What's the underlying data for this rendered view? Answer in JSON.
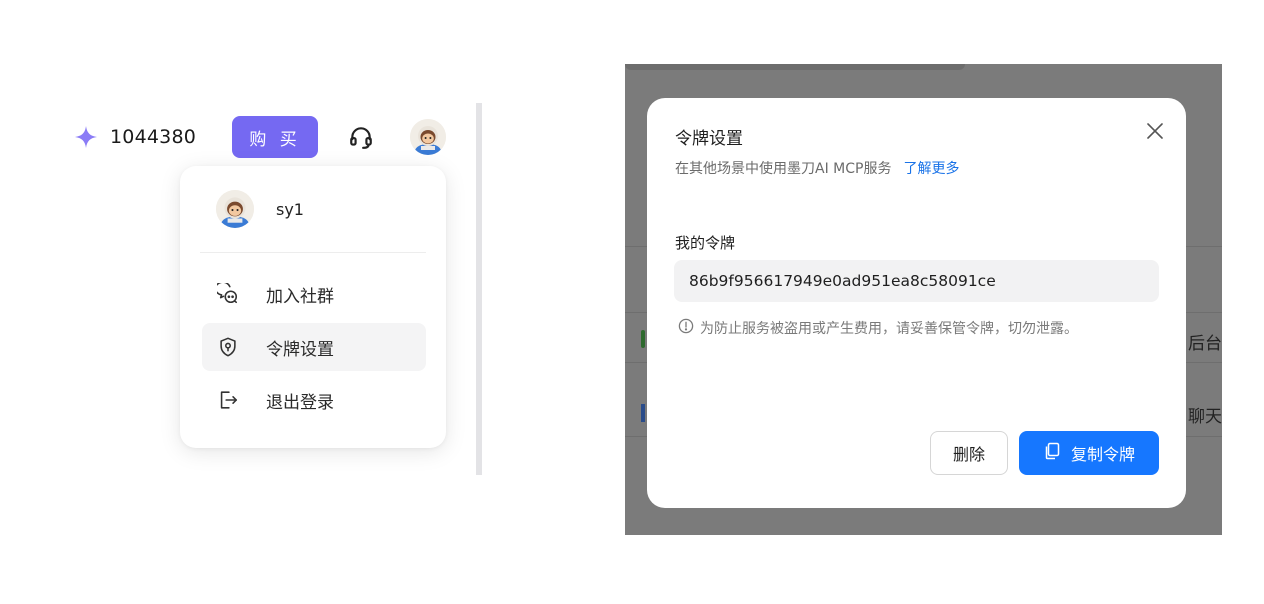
{
  "topbar": {
    "credits": "1044380",
    "buy_label": "购 买"
  },
  "user_menu": {
    "username": "sy1",
    "items": [
      {
        "label": "加入社群",
        "icon": "chat-bubbles-icon"
      },
      {
        "label": "令牌设置",
        "icon": "shield-icon",
        "active": true
      },
      {
        "label": "退出登录",
        "icon": "logout-icon"
      }
    ]
  },
  "backdrop": {
    "row1_text": "后台",
    "row2_text": "聊天"
  },
  "modal": {
    "title": "令牌设置",
    "subtitle": "在其他场景中使用墨刀AI MCP服务",
    "learn_more": "了解更多",
    "token_label": "我的令牌",
    "token_value": "86b9f956617949e0ad951ea8c58091ce",
    "note": "为防止服务被盗用或产生费用，请妥善保管令牌，切勿泄露。",
    "delete_label": "删除",
    "copy_label": "复制令牌"
  },
  "colors": {
    "accent_purple": "#7569f2",
    "primary_blue": "#1677ff",
    "link_blue": "#1a73e8"
  }
}
